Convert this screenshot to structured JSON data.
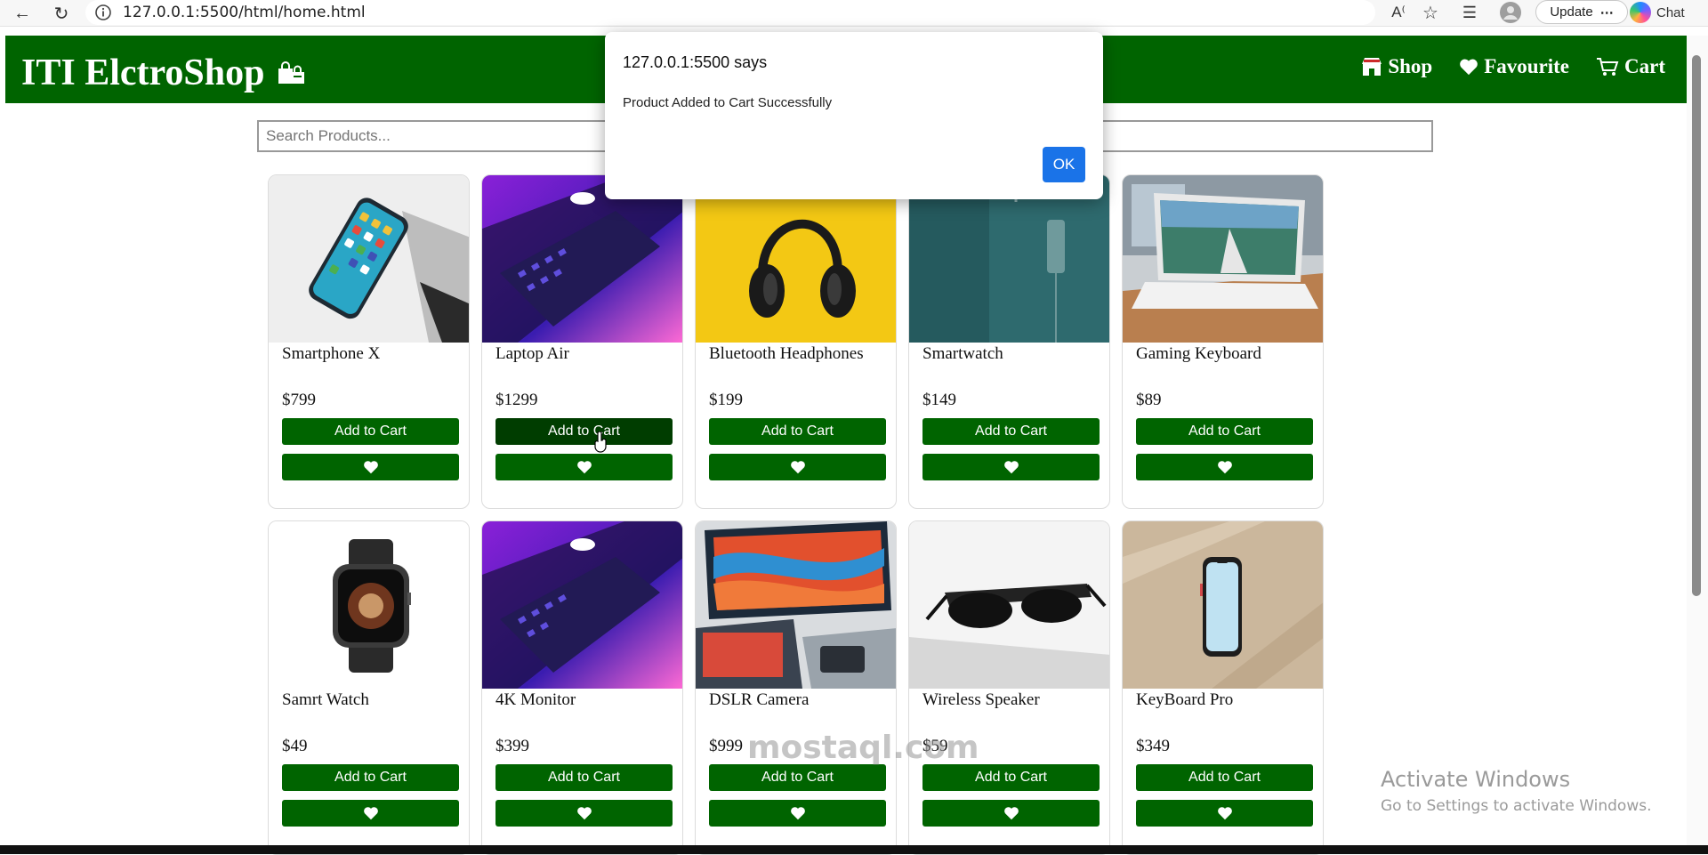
{
  "browser": {
    "url": "127.0.0.1:5500/html/home.html",
    "update_label": "Update",
    "chat_label": "Chat"
  },
  "site": {
    "brand": "ITI ElctroShop",
    "nav": [
      {
        "label": "Shop",
        "icon": "store-icon"
      },
      {
        "label": "Favourite",
        "icon": "heart-icon"
      },
      {
        "label": "Cart",
        "icon": "cart-icon"
      }
    ],
    "accent_color": "#006400"
  },
  "search": {
    "placeholder": "Search Products..."
  },
  "products": [
    {
      "name": "Smartphone X",
      "price": "$799",
      "add_label": "Add to Cart"
    },
    {
      "name": "Laptop Air",
      "price": "$1299",
      "add_label": "Add to Cart"
    },
    {
      "name": "Bluetooth Headphones",
      "price": "$199",
      "add_label": "Add to Cart"
    },
    {
      "name": "Smartwatch",
      "price": "$149",
      "add_label": "Add to Cart"
    },
    {
      "name": "Gaming Keyboard",
      "price": "$89",
      "add_label": "Add to Cart"
    },
    {
      "name": "Samrt Watch",
      "price": "$49",
      "add_label": "Add to Cart"
    },
    {
      "name": "4K Monitor",
      "price": "$399",
      "add_label": "Add to Cart"
    },
    {
      "name": "DSLR Camera",
      "price": "$999",
      "add_label": "Add to Cart"
    },
    {
      "name": "Wireless Speaker",
      "price": "$59",
      "add_label": "Add to Cart"
    },
    {
      "name": "KeyBoard Pro",
      "price": "$349",
      "add_label": "Add to Cart"
    }
  ],
  "dialog": {
    "title": "127.0.0.1:5500 says",
    "message": "Product Added to Cart Successfully",
    "ok_label": "OK"
  },
  "watermark": {
    "title": "Activate Windows",
    "subtitle": "Go to Settings to activate Windows.",
    "logo_text": "mostaql.com"
  }
}
